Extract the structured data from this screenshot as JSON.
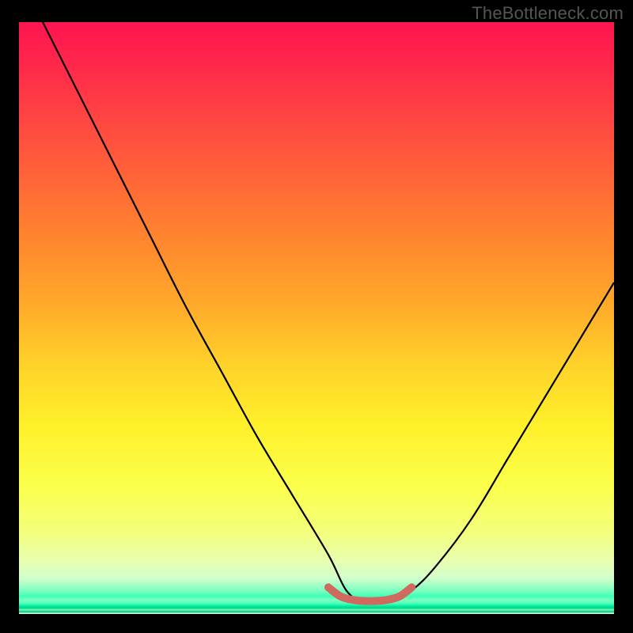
{
  "watermark": "TheBottleneck.com",
  "chart_data": {
    "type": "line",
    "title": "",
    "xlabel": "",
    "ylabel": "",
    "xlim": [
      0,
      100
    ],
    "ylim": [
      0,
      100
    ],
    "grid": false,
    "series": [
      {
        "name": "bottleneck-curve",
        "color": "#000000",
        "x": [
          4,
          10,
          16,
          22,
          28,
          34,
          40,
          46,
          52,
          55,
          58,
          62,
          66,
          70,
          76,
          82,
          88,
          94,
          100
        ],
        "y": [
          100,
          88,
          76,
          64,
          52,
          41,
          30,
          20,
          10,
          4,
          2,
          2,
          4,
          8,
          16,
          26,
          36,
          46,
          56
        ]
      },
      {
        "name": "minimum-band",
        "color": "#d16a5e",
        "x": [
          52,
          54,
          56,
          58,
          60,
          62,
          64,
          66
        ],
        "y": [
          4.5,
          3.0,
          2.4,
          2.2,
          2.2,
          2.4,
          3.0,
          4.5
        ]
      }
    ],
    "annotations": []
  },
  "colors": {
    "background": "#000000",
    "watermark": "#555555",
    "curve": "#000000",
    "minimum_band": "#d16a5e"
  }
}
